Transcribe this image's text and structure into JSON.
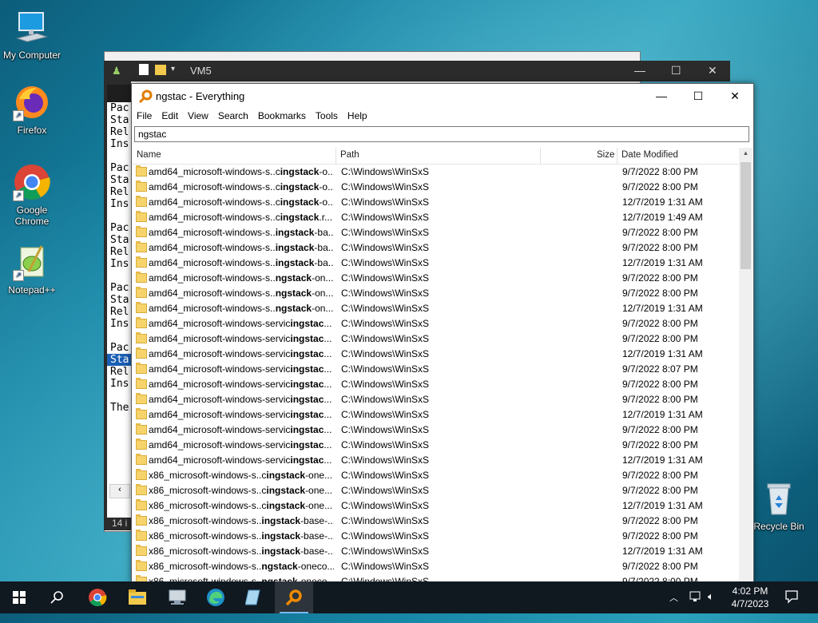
{
  "desktop": {
    "icons": [
      {
        "label": "My Computer",
        "icon": "monitor-icon"
      },
      {
        "label": "Firefox",
        "icon": "firefox-icon"
      },
      {
        "label": "Google Chrome",
        "icon": "chrome-icon"
      },
      {
        "label": "Notepad++",
        "icon": "notepadpp-icon"
      },
      {
        "label": "Recycle Bin",
        "icon": "recycle-bin-icon"
      }
    ]
  },
  "back_window": {
    "title": "VM5",
    "lines": [
      "Pac",
      "Sta",
      "Rel",
      "Ins",
      "",
      "Pac",
      "Sta",
      "Rel",
      "Ins",
      "",
      "Pac",
      "Sta",
      "Rel",
      "Ins",
      "",
      "Pac",
      "Sta",
      "Rel",
      "Ins",
      "",
      "Pac",
      "Sta",
      "Rel",
      "Ins",
      "",
      "The"
    ],
    "status": "14 i"
  },
  "everything": {
    "title": "ngstac - Everything",
    "menu": [
      "File",
      "Edit",
      "View",
      "Search",
      "Bookmarks",
      "Tools",
      "Help"
    ],
    "search_value": "ngstac",
    "columns": {
      "name": "Name",
      "path": "Path",
      "size": "Size",
      "date": "Date Modified"
    },
    "rows": [
      {
        "pre": "amd64_microsoft-windows-s..c",
        "hl": "ingstack",
        "post": "-o...",
        "path": "C:\\Windows\\WinSxS",
        "date": "9/7/2022 8:00 PM"
      },
      {
        "pre": "amd64_microsoft-windows-s..c",
        "hl": "ingstack",
        "post": "-o...",
        "path": "C:\\Windows\\WinSxS",
        "date": "9/7/2022 8:00 PM"
      },
      {
        "pre": "amd64_microsoft-windows-s..c",
        "hl": "ingstack",
        "post": "-o...",
        "path": "C:\\Windows\\WinSxS",
        "date": "12/7/2019 1:31 AM"
      },
      {
        "pre": "amd64_microsoft-windows-s..c",
        "hl": "ingstack",
        "post": ".r...",
        "path": "C:\\Windows\\WinSxS",
        "date": "12/7/2019 1:49 AM"
      },
      {
        "pre": "amd64_microsoft-windows-s..",
        "hl": "ingstack",
        "post": "-ba...",
        "path": "C:\\Windows\\WinSxS",
        "date": "9/7/2022 8:00 PM"
      },
      {
        "pre": "amd64_microsoft-windows-s..",
        "hl": "ingstack",
        "post": "-ba...",
        "path": "C:\\Windows\\WinSxS",
        "date": "9/7/2022 8:00 PM"
      },
      {
        "pre": "amd64_microsoft-windows-s..",
        "hl": "ingstack",
        "post": "-ba...",
        "path": "C:\\Windows\\WinSxS",
        "date": "12/7/2019 1:31 AM"
      },
      {
        "pre": "amd64_microsoft-windows-s..",
        "hl": "ngstack",
        "post": "-on...",
        "path": "C:\\Windows\\WinSxS",
        "date": "9/7/2022 8:00 PM"
      },
      {
        "pre": "amd64_microsoft-windows-s..",
        "hl": "ngstack",
        "post": "-on...",
        "path": "C:\\Windows\\WinSxS",
        "date": "9/7/2022 8:00 PM"
      },
      {
        "pre": "amd64_microsoft-windows-s..",
        "hl": "ngstack",
        "post": "-on...",
        "path": "C:\\Windows\\WinSxS",
        "date": "12/7/2019 1:31 AM"
      },
      {
        "pre": "amd64_microsoft-windows-servic",
        "hl": "ingstac",
        "post": "...",
        "path": "C:\\Windows\\WinSxS",
        "date": "9/7/2022 8:00 PM"
      },
      {
        "pre": "amd64_microsoft-windows-servic",
        "hl": "ingstac",
        "post": "...",
        "path": "C:\\Windows\\WinSxS",
        "date": "9/7/2022 8:00 PM"
      },
      {
        "pre": "amd64_microsoft-windows-servic",
        "hl": "ingstac",
        "post": "...",
        "path": "C:\\Windows\\WinSxS",
        "date": "12/7/2019 1:31 AM"
      },
      {
        "pre": "amd64_microsoft-windows-servic",
        "hl": "ingstac",
        "post": "...",
        "path": "C:\\Windows\\WinSxS",
        "date": "9/7/2022 8:07 PM"
      },
      {
        "pre": "amd64_microsoft-windows-servic",
        "hl": "ingstac",
        "post": "...",
        "path": "C:\\Windows\\WinSxS",
        "date": "9/7/2022 8:00 PM"
      },
      {
        "pre": "amd64_microsoft-windows-servic",
        "hl": "ingstac",
        "post": "...",
        "path": "C:\\Windows\\WinSxS",
        "date": "9/7/2022 8:00 PM"
      },
      {
        "pre": "amd64_microsoft-windows-servic",
        "hl": "ingstac",
        "post": "...",
        "path": "C:\\Windows\\WinSxS",
        "date": "12/7/2019 1:31 AM"
      },
      {
        "pre": "amd64_microsoft-windows-servic",
        "hl": "ingstac",
        "post": "...",
        "path": "C:\\Windows\\WinSxS",
        "date": "9/7/2022 8:00 PM"
      },
      {
        "pre": "amd64_microsoft-windows-servic",
        "hl": "ingstac",
        "post": "...",
        "path": "C:\\Windows\\WinSxS",
        "date": "9/7/2022 8:00 PM"
      },
      {
        "pre": "amd64_microsoft-windows-servic",
        "hl": "ingstac",
        "post": "...",
        "path": "C:\\Windows\\WinSxS",
        "date": "12/7/2019 1:31 AM"
      },
      {
        "pre": "x86_microsoft-windows-s..c",
        "hl": "ingstack",
        "post": "-one...",
        "path": "C:\\Windows\\WinSxS",
        "date": "9/7/2022 8:00 PM"
      },
      {
        "pre": "x86_microsoft-windows-s..c",
        "hl": "ingstack",
        "post": "-one...",
        "path": "C:\\Windows\\WinSxS",
        "date": "9/7/2022 8:00 PM"
      },
      {
        "pre": "x86_microsoft-windows-s..c",
        "hl": "ingstack",
        "post": "-one...",
        "path": "C:\\Windows\\WinSxS",
        "date": "12/7/2019 1:31 AM"
      },
      {
        "pre": "x86_microsoft-windows-s..",
        "hl": "ingstack",
        "post": "-base-...",
        "path": "C:\\Windows\\WinSxS",
        "date": "9/7/2022 8:00 PM"
      },
      {
        "pre": "x86_microsoft-windows-s..",
        "hl": "ingstack",
        "post": "-base-...",
        "path": "C:\\Windows\\WinSxS",
        "date": "9/7/2022 8:00 PM"
      },
      {
        "pre": "x86_microsoft-windows-s..",
        "hl": "ingstack",
        "post": "-base-...",
        "path": "C:\\Windows\\WinSxS",
        "date": "12/7/2019 1:31 AM"
      },
      {
        "pre": "x86_microsoft-windows-s..",
        "hl": "ngstack",
        "post": "-oneco...",
        "path": "C:\\Windows\\WinSxS",
        "date": "9/7/2022 8:00 PM"
      },
      {
        "pre": "x86_microsoft-windows-s..",
        "hl": "ngstack",
        "post": "-oneco...",
        "path": "C:\\Windows\\WinSxS",
        "date": "9/7/2022 8:00 PM"
      }
    ]
  },
  "taskbar": {
    "items": [
      "start-icon",
      "search-icon",
      "chrome-icon",
      "file-explorer-icon",
      "network-folder-icon",
      "edge-icon",
      "notepad-icon",
      "everything-icon"
    ],
    "clock_time": "4:02 PM",
    "clock_date": "4/7/2023",
    "colors": {
      "accent": "#76b9ed",
      "taskbar_bg": "#101820"
    }
  }
}
